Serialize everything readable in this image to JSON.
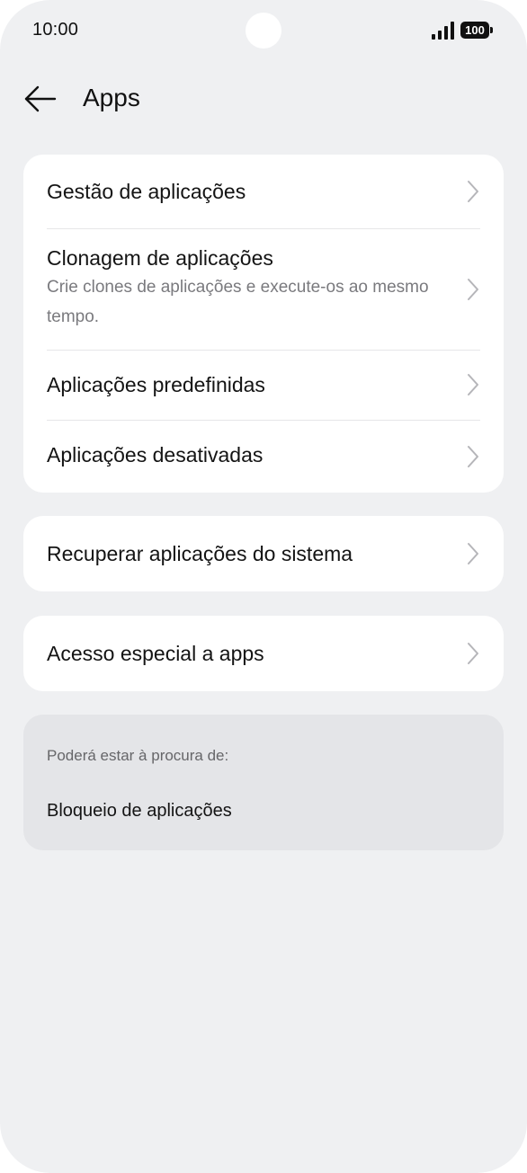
{
  "status_bar": {
    "time": "10:00",
    "battery": "100",
    "icons": [
      "camera-cutout",
      "signal-icon",
      "battery-icon"
    ]
  },
  "header": {
    "title": "Apps",
    "back_icon": "arrow-left-icon"
  },
  "group_main": {
    "items": [
      {
        "title": "Gestão de aplicações"
      },
      {
        "title": "Clonagem de aplicações",
        "subtitle": "Crie clones de aplicações e execute-os ao mesmo tempo."
      },
      {
        "title": "Aplicações predefinidas"
      },
      {
        "title": "Aplicações desativadas"
      }
    ]
  },
  "group_recover": {
    "title": "Recuperar aplicações do sistema"
  },
  "group_special": {
    "title": "Acesso especial a apps"
  },
  "suggestions": {
    "label": "Poderá estar à procura de:",
    "items": [
      "Bloqueio de aplicações"
    ]
  },
  "colors": {
    "background": "#eff0f2",
    "card": "#ffffff",
    "suggestion_card": "#e4e5e8",
    "text": "#141414",
    "secondary_text": "#7a7a7e",
    "chevron": "#b5b5b9"
  }
}
